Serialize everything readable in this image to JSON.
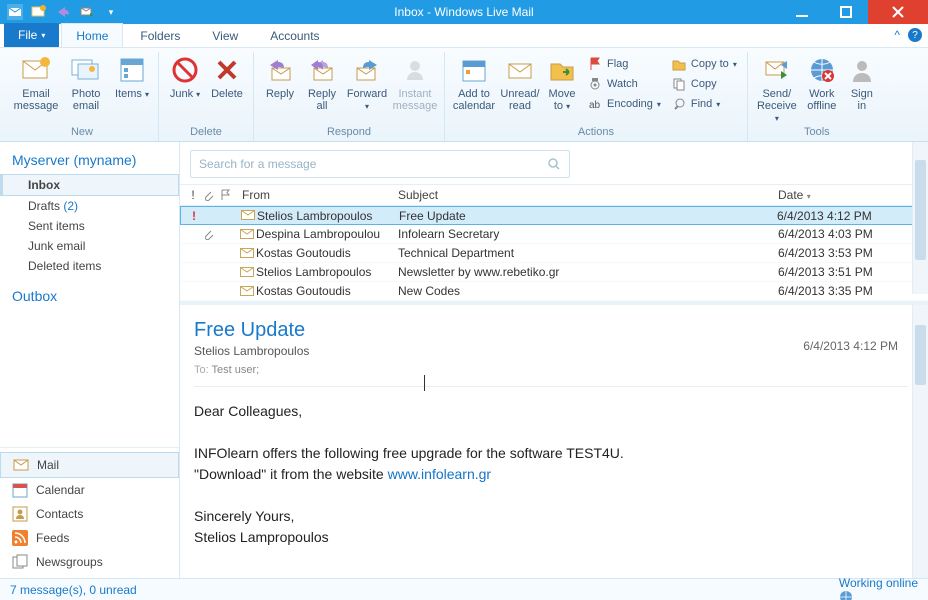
{
  "window": {
    "title": "Inbox - Windows Live Mail"
  },
  "tabs": {
    "file": "File",
    "home": "Home",
    "folders": "Folders",
    "view": "View",
    "accounts": "Accounts"
  },
  "ribbon": {
    "groups": {
      "new": {
        "label": "New",
        "email": "Email\nmessage",
        "photo": "Photo\nemail",
        "items": "Items"
      },
      "delete": {
        "label": "Delete",
        "junk": "Junk",
        "delete": "Delete"
      },
      "respond": {
        "label": "Respond",
        "reply": "Reply",
        "replyall": "Reply\nall",
        "forward": "Forward",
        "instant": "Instant\nmessage"
      },
      "actions": {
        "label": "Actions",
        "calendar": "Add to\ncalendar",
        "unread": "Unread/\nread",
        "move": "Move\nto",
        "flag": "Flag",
        "watch": "Watch",
        "encoding": "Encoding",
        "copyto": "Copy to",
        "copy": "Copy",
        "find": "Find"
      },
      "tools": {
        "label": "Tools",
        "send": "Send/\nReceive",
        "offline": "Work\noffline",
        "signin": "Sign\nin"
      }
    }
  },
  "account": {
    "name": "Myserver (myname)"
  },
  "folders": {
    "inbox": "Inbox",
    "drafts": {
      "label": "Drafts",
      "count": "(2)"
    },
    "sent": "Sent items",
    "junk": "Junk email",
    "deleted": "Deleted items"
  },
  "outbox": "Outbox",
  "nav": {
    "mail": "Mail",
    "calendar": "Calendar",
    "contacts": "Contacts",
    "feeds": "Feeds",
    "newsgroups": "Newsgroups"
  },
  "search": {
    "placeholder": "Search for a message"
  },
  "columns": {
    "from": "From",
    "subject": "Subject",
    "date": "Date"
  },
  "messages": [
    {
      "priority": "!",
      "att": "",
      "from": "Stelios Lambropoulos",
      "subject": "Free Update",
      "date": "6/4/2013 4:12 PM",
      "selected": true
    },
    {
      "priority": "",
      "att": "📎",
      "from": "Despina Lambropoulou",
      "subject": "Infolearn Secretary",
      "date": "6/4/2013 4:03 PM"
    },
    {
      "priority": "",
      "att": "",
      "from": "Kostas Goutoudis",
      "subject": "Technical Department",
      "date": "6/4/2013 3:53 PM"
    },
    {
      "priority": "",
      "att": "",
      "from": "Stelios Lambropoulos",
      "subject": "Newsletter by www.rebetiko.gr",
      "date": "6/4/2013 3:51 PM"
    },
    {
      "priority": "",
      "att": "",
      "from": "Kostas Goutoudis",
      "subject": "New Codes",
      "date": "6/4/2013 3:35 PM"
    }
  ],
  "reading": {
    "subject": "Free Update",
    "from": "Stelios Lambropoulos",
    "to_label": "To:",
    "to": "Test user;",
    "date": "6/4/2013 4:12 PM",
    "line1": "Dear Colleagues,",
    "line2a": "INFOlearn offers the following free upgrade for the software TEST4U.",
    "line2b": "\"Download\" it from the website ",
    "link": "www.infolearn.gr",
    "line3": "Sincerely Yours,",
    "line4": "Stelios Lampropoulos"
  },
  "status": {
    "left": "7 message(s), 0 unread",
    "right": "Working online"
  }
}
